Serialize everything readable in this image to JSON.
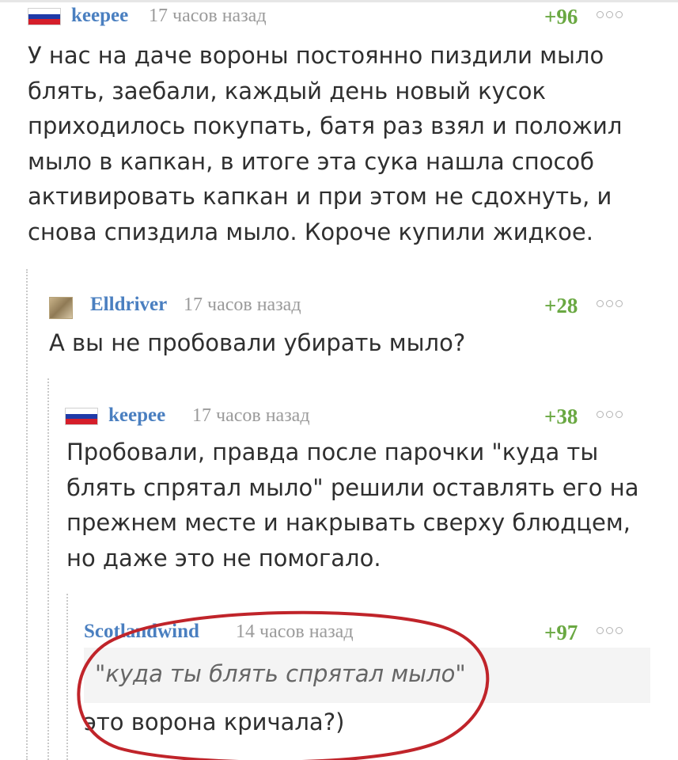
{
  "comments": [
    {
      "username": "keepee",
      "time": "17 часов назад",
      "rating": "+96",
      "text": "У нас на даче вороны постоянно пиздили мыло\nблять, заебали, каждый день новый кусок\nприходилось покупать, батя раз взял и положил\nмыло в капкан, в итоге эта сука нашла способ\nактивировать капкан и при этом не сдохнуть, и\nснова спиздила мыло. Короче купили жидкое."
    },
    {
      "username": "Elldriver",
      "time": "17 часов назад",
      "rating": "+28",
      "text": "А вы не пробовали убирать мыло?"
    },
    {
      "username": "keepee",
      "time": "17 часов назад",
      "rating": "+38",
      "text": "Пробовали, правда после парочки \"куда ты\nблять спрятал мыло\" решили оставлять его на\nпрежнем месте и накрывать сверху блюдцем,\nно даже это не помогало."
    },
    {
      "username": "Scotlandwind",
      "time": "14 часов назад",
      "rating": "+97",
      "quote": "\"куда ты блять спрятал мыло\"",
      "text": "это ворона кричала?)"
    }
  ],
  "colors": {
    "username": "#4a7fc0",
    "rating": "#6aa842",
    "annotation": "#c0242a"
  }
}
